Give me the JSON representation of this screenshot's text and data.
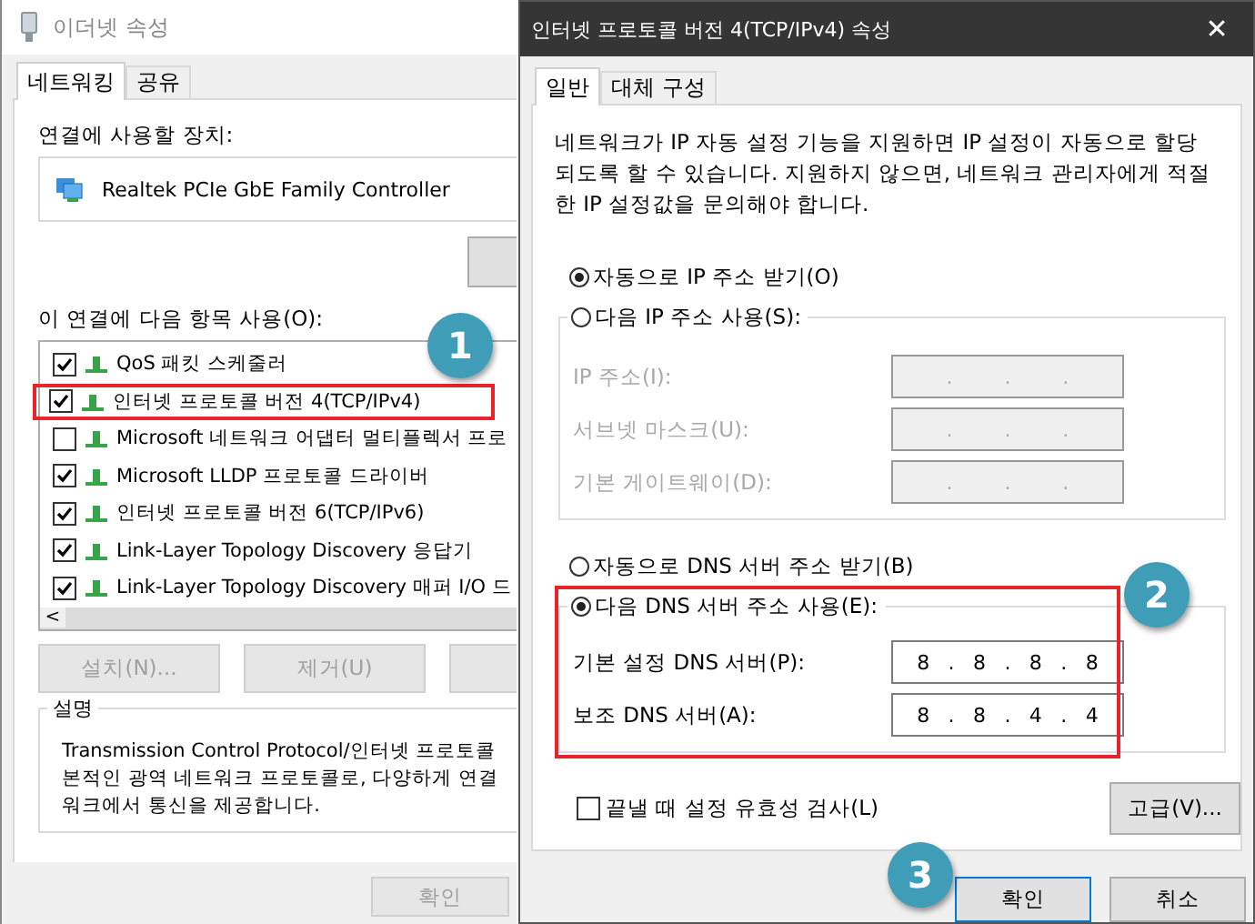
{
  "back_window": {
    "title": "이더넷 속성",
    "tabs": [
      {
        "label": "네트워킹",
        "selected": true
      },
      {
        "label": "공유",
        "selected": false
      }
    ],
    "device_label": "연결에 사용할 장치:",
    "device": "Realtek PCIe GbE Family Controller",
    "items_label": "이 연결에 다음 항목 사용(O):",
    "items": [
      {
        "label": "QoS 패킷 스케줄러",
        "checked": true,
        "highlighted": false
      },
      {
        "label": "인터넷 프로토콜 버전 4(TCP/IPv4)",
        "checked": true,
        "highlighted": true
      },
      {
        "label": "Microsoft 네트워크 어댑터 멀티플렉서 프로",
        "checked": false,
        "highlighted": false
      },
      {
        "label": "Microsoft LLDP 프로토콜 드라이버",
        "checked": true,
        "highlighted": false
      },
      {
        "label": "인터넷 프로토콜 버전 6(TCP/IPv6)",
        "checked": true,
        "highlighted": false
      },
      {
        "label": "Link-Layer Topology Discovery 응답기",
        "checked": true,
        "highlighted": false
      },
      {
        "label": "Link-Layer Topology Discovery 매퍼 I/O 드",
        "checked": true,
        "highlighted": false
      }
    ],
    "scroll_arrow": "<",
    "buttons": [
      {
        "label": "설치(N)...",
        "disabled": true
      },
      {
        "label": "제거(U)",
        "disabled": true
      }
    ],
    "description_title": "설명",
    "description_lines": [
      "Transmission Control Protocol/인터넷 프로토콜",
      "본적인 광역 네트워크 프로토콜로, 다양하게 연결",
      "워크에서 통신을 제공합니다."
    ],
    "ok_button": "확인"
  },
  "dialog": {
    "title": "인터넷 프로토콜 버전 4(TCP/IPv4) 속성",
    "close": "✕",
    "tabs": [
      {
        "label": "일반",
        "selected": true
      },
      {
        "label": "대체 구성",
        "selected": false
      }
    ],
    "intro": "네트워크가 IP 자동 설정 기능을 지원하면 IP 설정이 자동으로 할당되도록 할 수 있습니다. 지원하지 않으면, 네트워크 관리자에게 적절한 IP 설정값을 문의해야 합니다.",
    "ip_radios": [
      {
        "label": "자동으로 IP 주소 받기(O)",
        "selected": true
      },
      {
        "label": "다음 IP 주소 사용(S):",
        "selected": false
      }
    ],
    "ip_fields": [
      {
        "label": "IP 주소(I):",
        "disabled": true,
        "separators": [
          ".",
          ".",
          "."
        ]
      },
      {
        "label": "서브넷 마스크(U):",
        "disabled": true,
        "separators": [
          ".",
          ".",
          "."
        ]
      },
      {
        "label": "기본 게이트웨이(D):",
        "disabled": true,
        "separators": [
          ".",
          ".",
          "."
        ]
      }
    ],
    "dns_radios": [
      {
        "label": "자동으로 DNS 서버 주소 받기(B)",
        "selected": false
      },
      {
        "label": "다음 DNS 서버 주소 사용(E):",
        "selected": true
      }
    ],
    "dns_highlighted": true,
    "dns_fields": [
      {
        "label": "기본 설정 DNS 서버(P):",
        "disabled": false,
        "octets": [
          "8",
          "8",
          "8",
          "8"
        ],
        "separators": [
          ".",
          ".",
          "."
        ]
      },
      {
        "label": "보조 DNS 서버(A):",
        "disabled": false,
        "octets": [
          "8",
          "8",
          "4",
          "4"
        ],
        "separators": [
          ".",
          ".",
          "."
        ]
      }
    ],
    "validate": {
      "label": "끝낼 때 설정 유효성 검사(L)",
      "checked": false
    },
    "advanced_button": "고급(V)...",
    "ok_button": "확인",
    "cancel_button": "취소"
  },
  "callouts": [
    "1",
    "2",
    "3"
  ]
}
